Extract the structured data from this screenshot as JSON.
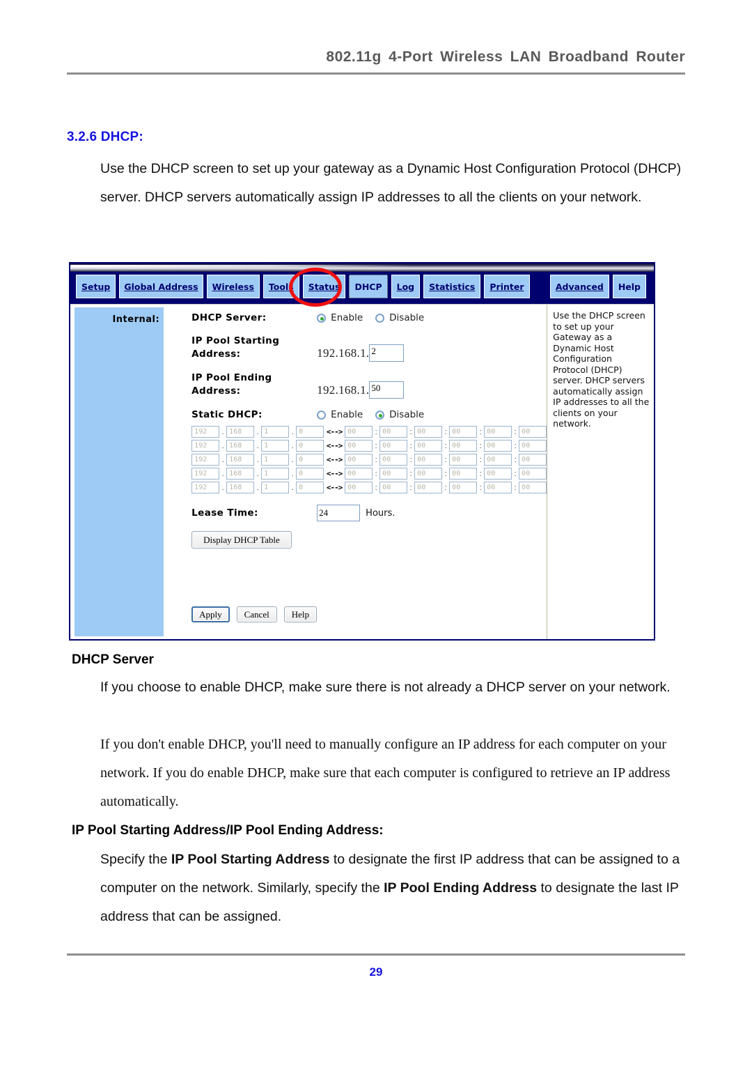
{
  "header": {
    "title": "802.11g 4-Port Wireless LAN Broadband Router"
  },
  "section": {
    "heading": "3.2.6 DHCP:",
    "intro": "Use the DHCP screen to set up your gateway as a Dynamic Host Configuration Protocol (DHCP) server. DHCP servers automatically assign IP addresses to all the clients on your network."
  },
  "router_ui": {
    "tabs_left": [
      {
        "label": "Setup",
        "highlighted": false
      },
      {
        "label": "Global Address",
        "highlighted": false
      },
      {
        "label": "Wireless",
        "highlighted": false
      },
      {
        "label": "Tools",
        "highlighted": false
      },
      {
        "label": "Status",
        "highlighted": false
      },
      {
        "label": "DHCP",
        "highlighted": true
      },
      {
        "label": "Log",
        "highlighted": false
      },
      {
        "label": "Statistics",
        "highlighted": false
      },
      {
        "label": "Printer",
        "highlighted": false
      }
    ],
    "tabs_right": [
      {
        "label": "Advanced"
      },
      {
        "label": "Help"
      }
    ],
    "sidebar_label": "Internal:",
    "fields": {
      "dhcp_server_label": "DHCP Server:",
      "dhcp_server_enable": "Enable",
      "dhcp_server_disable": "Disable",
      "dhcp_server_value": "Enable",
      "pool_start_label": "IP Pool Starting Address:",
      "pool_start_prefix": "192.168.1.",
      "pool_start_value": "2",
      "pool_end_label": "IP Pool Ending Address:",
      "pool_end_prefix": "192.168.1.",
      "pool_end_value": "50",
      "static_dhcp_label": "Static DHCP:",
      "static_dhcp_enable": "Enable",
      "static_dhcp_disable": "Disable",
      "static_dhcp_value": "Disable",
      "lease_time_label": "Lease Time:",
      "lease_time_value": "24",
      "lease_time_unit": "Hours."
    },
    "static_table": {
      "rows": [
        {
          "ip": [
            "192",
            "168",
            "1",
            "0"
          ],
          "mac": [
            "00",
            "00",
            "00",
            "00",
            "00",
            "00"
          ]
        },
        {
          "ip": [
            "192",
            "168",
            "1",
            "0"
          ],
          "mac": [
            "00",
            "00",
            "00",
            "00",
            "00",
            "00"
          ]
        },
        {
          "ip": [
            "192",
            "168",
            "1",
            "0"
          ],
          "mac": [
            "00",
            "00",
            "00",
            "00",
            "00",
            "00"
          ]
        },
        {
          "ip": [
            "192",
            "168",
            "1",
            "0"
          ],
          "mac": [
            "00",
            "00",
            "00",
            "00",
            "00",
            "00"
          ]
        },
        {
          "ip": [
            "192",
            "168",
            "1",
            "0"
          ],
          "mac": [
            "00",
            "00",
            "00",
            "00",
            "00",
            "00"
          ]
        }
      ],
      "ip_separator": ".",
      "mac_separator": ":",
      "link_arrow": "<-->"
    },
    "buttons": {
      "display_table": "Display DHCP Table",
      "apply": "Apply",
      "cancel": "Cancel",
      "help": "Help"
    },
    "help_pane": "Use the DHCP screen to set up your Gateway as a Dynamic Host Configuration Protocol (DHCP) server. DHCP servers automatically assign IP addresses to all the clients on your network."
  },
  "body": {
    "dhcp_server_heading": "DHCP Server",
    "dhcp_server_para_sans": "If you choose to enable DHCP, make sure there is not already a DHCP server on your network.",
    "dhcp_server_para_serif": "If you don't enable DHCP, you'll need to manually configure an IP address for each computer on your network. If you do enable DHCP, make sure that each computer is configured to retrieve an IP address automatically.",
    "ip_pool_heading": "IP Pool Starting Address/IP Pool Ending Address:",
    "ip_pool_para_1": "Specify the ",
    "ip_pool_bold_1": "IP Pool Starting Address",
    "ip_pool_para_2": " to designate the first IP address that can be assigned to a computer on the network. Similarly, specify the ",
    "ip_pool_bold_2": "IP Pool Ending Address",
    "ip_pool_para_3": " to designate the last IP address that can be assigned."
  },
  "footer": {
    "page_number": "29"
  },
  "colors": {
    "heading_blue": "#1414e0",
    "nav_navy": "#00006e",
    "tab_blue": "#9ecbf5",
    "annotation_red": "#ee1111",
    "radio_green": "#2faa2f"
  }
}
